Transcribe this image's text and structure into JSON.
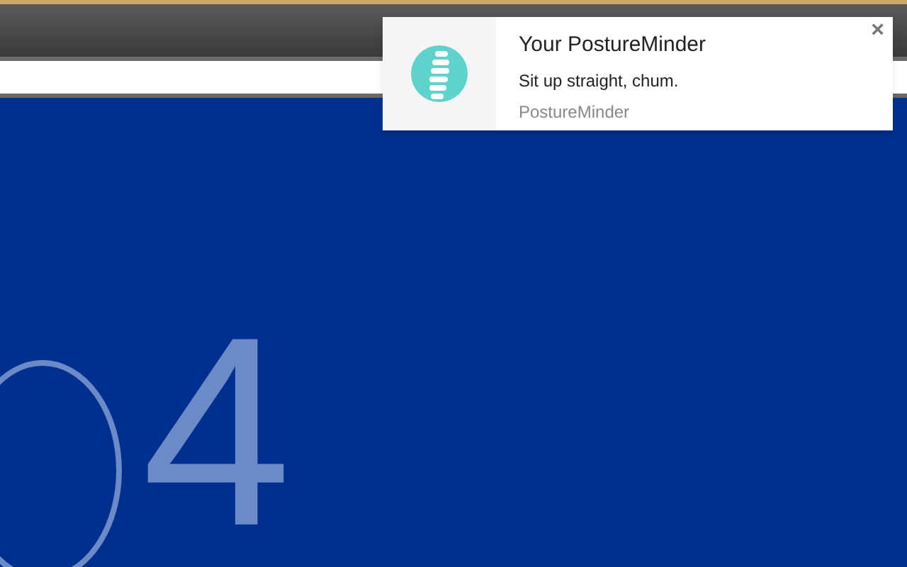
{
  "page": {
    "big_number": "4"
  },
  "notification": {
    "title": "Your PostureMinder",
    "message": "Sit up straight, chum.",
    "source": "PostureMinder",
    "close": "×"
  }
}
